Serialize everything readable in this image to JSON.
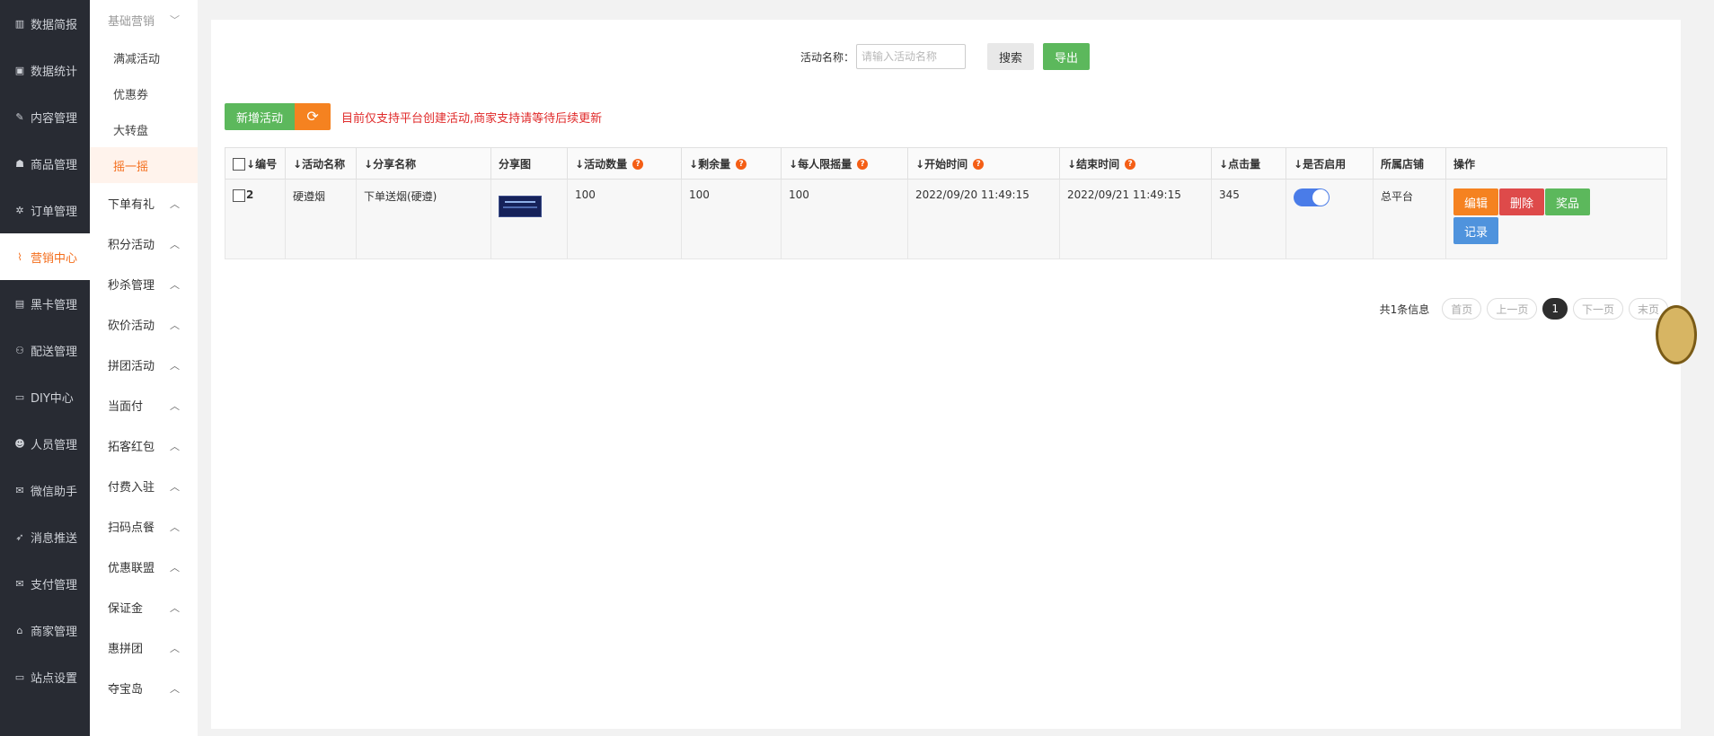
{
  "nav": {
    "items": [
      {
        "icon": "bar-chart-icon",
        "glyph": "▥",
        "label": "数据简报"
      },
      {
        "icon": "money-icon",
        "glyph": "▣",
        "label": "数据统计"
      },
      {
        "icon": "tag-icon",
        "glyph": "✎",
        "label": "内容管理"
      },
      {
        "icon": "shop-icon",
        "glyph": "☗",
        "label": "商品管理"
      },
      {
        "icon": "order-icon",
        "glyph": "✲",
        "label": "订单管理"
      },
      {
        "icon": "line-chart-icon",
        "glyph": "⌇",
        "label": "营销中心",
        "active": true
      },
      {
        "icon": "id-card-icon",
        "glyph": "▤",
        "label": "黑卡管理"
      },
      {
        "icon": "motorcycle-icon",
        "glyph": "⚇",
        "label": "配送管理"
      },
      {
        "icon": "desktop-icon",
        "glyph": "▭",
        "label": "DIY中心"
      },
      {
        "icon": "users-icon",
        "glyph": "☻",
        "label": "人员管理"
      },
      {
        "icon": "wechat-icon",
        "glyph": "✉",
        "label": "微信助手"
      },
      {
        "icon": "send-icon",
        "glyph": "➶",
        "label": "消息推送"
      },
      {
        "icon": "payment-icon",
        "glyph": "✉",
        "label": "支付管理"
      },
      {
        "icon": "bank-icon",
        "glyph": "⌂",
        "label": "商家管理"
      },
      {
        "icon": "monitor-icon",
        "glyph": "▭",
        "label": "站点设置"
      }
    ]
  },
  "submenu": {
    "head": "基础营销",
    "links": [
      "满减活动",
      "优惠券",
      "大转盘",
      "摇一摇"
    ],
    "active_index": 3,
    "groups": [
      "下单有礼",
      "积分活动",
      "秒杀管理",
      "砍价活动",
      "拼团活动",
      "当面付",
      "拓客红包",
      "付费入驻",
      "扫码点餐",
      "优惠联盟",
      "保证金",
      "惠拼团",
      "夺宝岛"
    ]
  },
  "search": {
    "label": "活动名称：",
    "placeholder": "请输入活动名称",
    "search_button": "搜索",
    "export_button": "导出"
  },
  "toolbar": {
    "add_button": "新增活动",
    "notice": "目前仅支持平台创建活动,商家支持请等待后续更新"
  },
  "table": {
    "headers": {
      "id": "编号",
      "name": "活动名称",
      "share_name": "分享名称",
      "share_img": "分享图",
      "count": "活动数量",
      "remain": "剩余量",
      "limit": "每人限摇量",
      "start": "开始时间",
      "end": "结束时间",
      "clicks": "点击量",
      "enabled": "是否启用",
      "store": "所属店铺",
      "ops": "操作"
    },
    "rows": [
      {
        "id": "2",
        "name": "硬遵烟",
        "share_name": "下单送烟(硬遵)",
        "count": "100",
        "remain": "100",
        "limit": "100",
        "start": "2022/09/20 11:49:15",
        "end": "2022/09/21 11:49:15",
        "clicks": "345",
        "enabled": true,
        "store": "总平台",
        "ops": {
          "edit": "编辑",
          "delete": "删除",
          "prize": "奖品",
          "record": "记录"
        }
      }
    ]
  },
  "pager": {
    "total": "共1条信息",
    "first": "首页",
    "prev": "上一页",
    "current": "1",
    "next": "下一页",
    "last": "末页"
  },
  "colors": {
    "accent": "#f46d1b",
    "green": "#5cb85c",
    "red": "#de4a4a",
    "blue": "#4f93dd",
    "nav_bg": "#282b33"
  }
}
